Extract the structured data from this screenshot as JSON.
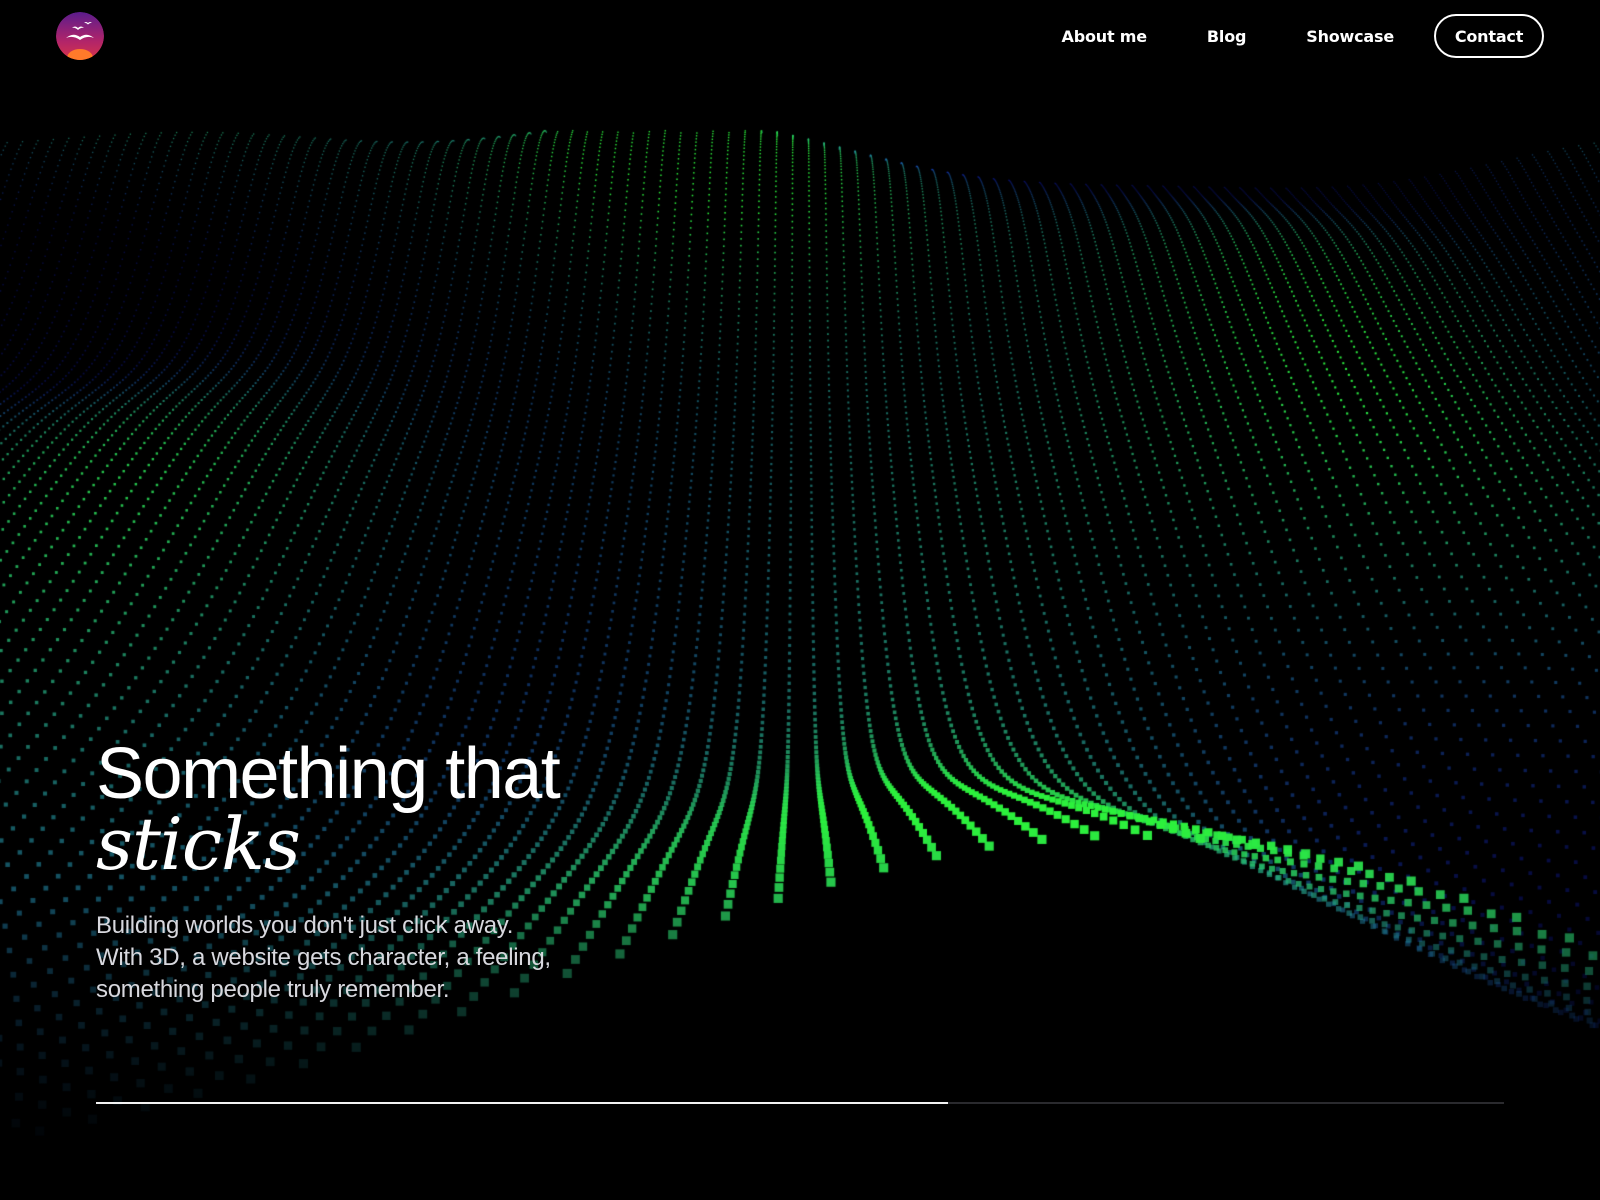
{
  "header": {
    "logo_icon": "seagulls-sunset-logo-icon",
    "nav": [
      {
        "label": "About me"
      },
      {
        "label": "Blog"
      },
      {
        "label": "Showcase"
      }
    ],
    "contact_label": "Contact"
  },
  "hero": {
    "title_line1": "Something that",
    "title_line2": "sticks",
    "subtitle_lines": [
      "Building worlds you don't just click away.",
      "With 3D, a website gets character, a feeling,",
      "something people truly remember."
    ]
  },
  "progress": {
    "value": 0.605
  },
  "colors": {
    "background": "#000000",
    "wave_green": "#2cf03c",
    "wave_blue": "#1a2cff",
    "text": "#ffffff"
  },
  "background_icon": "particle-wave-terrain"
}
